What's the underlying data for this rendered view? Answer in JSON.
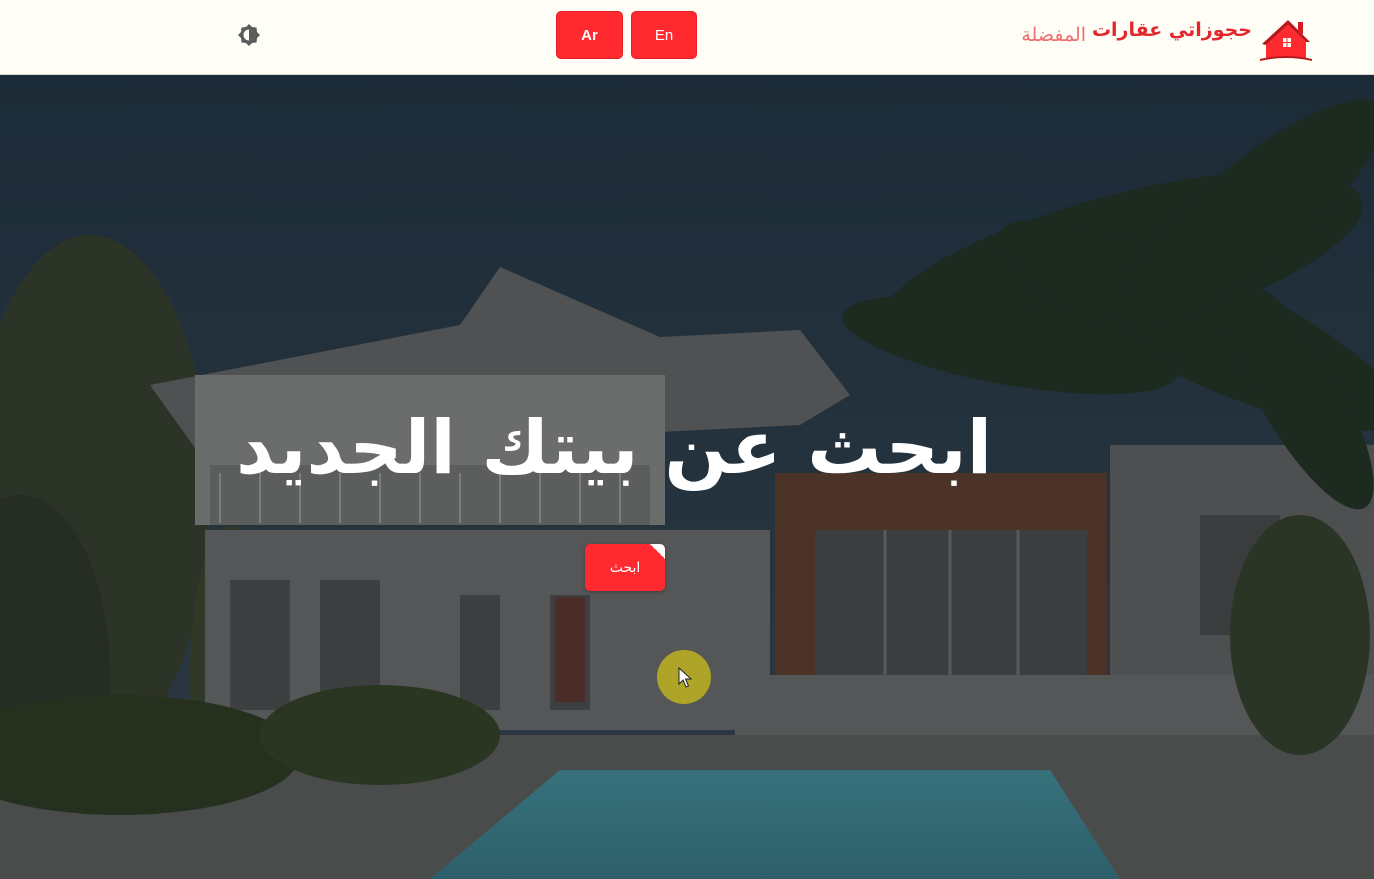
{
  "header": {
    "brand_name": "حجوزاتي عقارات",
    "brand_logo_icon": "house-icon",
    "favorites_label": "المفضلة",
    "lang_ar_label": "Ar",
    "lang_en_label": "En",
    "theme_toggle_icon": "brightness-icon"
  },
  "hero": {
    "title": "ابحث عن بيتك الجديد",
    "search_button_label": "ابحث",
    "background_image": "house-with-pool-photo"
  },
  "colors": {
    "accent": "#ff2a30",
    "brand_text": "#e4262d",
    "favorites_text": "#f06e72",
    "navbar_bg": "#fffef6",
    "cursor_highlight": "#beb21e"
  }
}
